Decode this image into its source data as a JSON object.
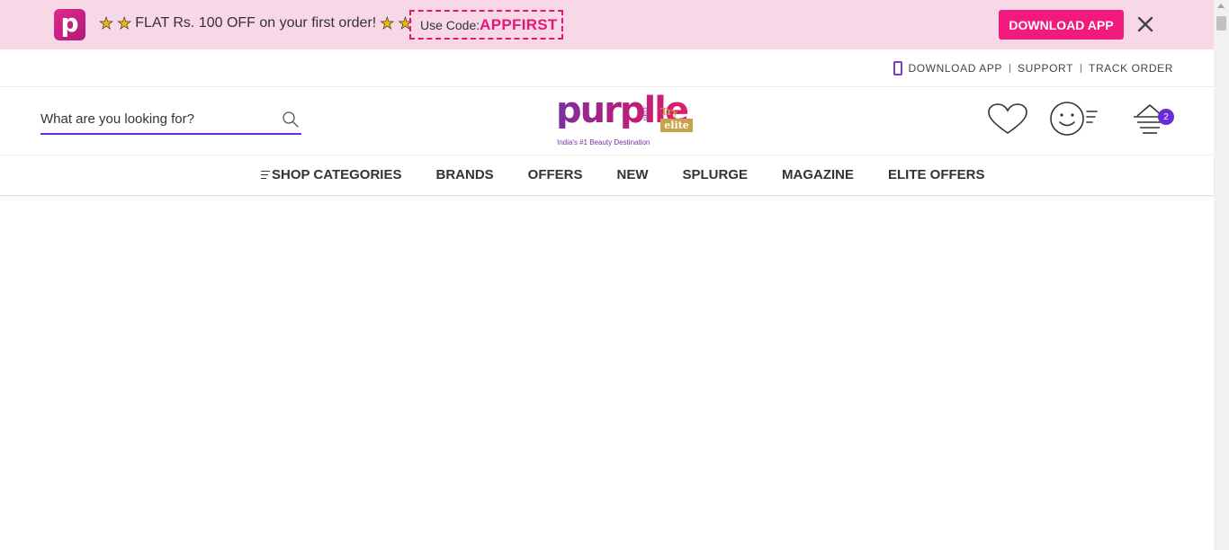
{
  "promo": {
    "app_logo_letter": "p",
    "offer_text": "FLAT Rs. 100 OFF on your first order!",
    "code_label": "Use Code:",
    "code_value": "APPFIRST",
    "download_button": "DOWNLOAD APP",
    "colors": {
      "background": "#f8d7e7",
      "accent": "#f21a7d"
    }
  },
  "utility": {
    "download_app": "DOWNLOAD APP",
    "support": "SUPPORT",
    "track_order": "TRACK ORDER"
  },
  "search": {
    "placeholder": "What are you looking for?"
  },
  "logo": {
    "word": "purplle",
    "com": ".com",
    "try": "Try",
    "elite": "elite",
    "tagline": "India's #1 Beauty Destination"
  },
  "header_icons": [
    "heart-icon",
    "account-icon",
    "cart-icon"
  ],
  "cart": {
    "count": "2"
  },
  "nav": {
    "items": [
      "SHOP CATEGORIES",
      "BRANDS",
      "OFFERS",
      "NEW",
      "SPLURGE",
      "MAGAZINE",
      "ELITE OFFERS"
    ]
  }
}
